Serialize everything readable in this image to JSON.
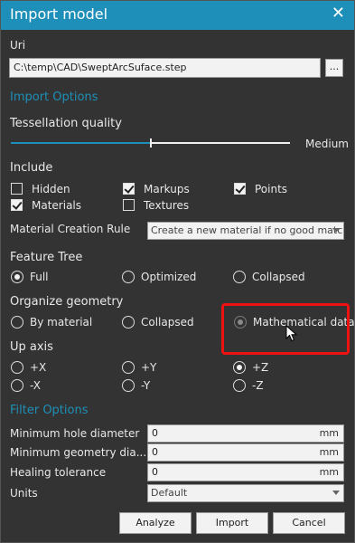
{
  "window": {
    "title": "Import model"
  },
  "uri": {
    "label": "Uri",
    "value": "C:\\temp\\CAD\\SweptArcSuface.step",
    "browse_label": "..."
  },
  "import_options": {
    "heading": "Import Options"
  },
  "tessellation": {
    "label": "Tessellation quality",
    "value_label": "Medium",
    "level": 0.5
  },
  "include": {
    "heading": "Include",
    "items": [
      {
        "label": "Hidden",
        "checked": false
      },
      {
        "label": "Markups",
        "checked": true
      },
      {
        "label": "Points",
        "checked": true
      },
      {
        "label": "Materials",
        "checked": true
      },
      {
        "label": "Textures",
        "checked": false
      }
    ]
  },
  "material_rule": {
    "label": "Material Creation Rule",
    "value": "Create a new material if no good matc..."
  },
  "feature_tree": {
    "heading": "Feature Tree",
    "options": [
      {
        "label": "Full",
        "selected": true
      },
      {
        "label": "Optimized",
        "selected": false
      },
      {
        "label": "Collapsed",
        "selected": false
      }
    ]
  },
  "organize": {
    "heading": "Organize geometry",
    "options": [
      {
        "label": "By material",
        "selected": false
      },
      {
        "label": "Collapsed",
        "selected": false
      },
      {
        "label": "Mathematical data",
        "selected": true
      }
    ]
  },
  "up_axis": {
    "heading": "Up axis",
    "options": [
      {
        "label": "+X",
        "selected": false
      },
      {
        "label": "+Y",
        "selected": false
      },
      {
        "label": "+Z",
        "selected": true
      },
      {
        "label": "-X",
        "selected": false
      },
      {
        "label": "-Y",
        "selected": false
      },
      {
        "label": "-Z",
        "selected": false
      }
    ]
  },
  "filter": {
    "heading": "Filter Options",
    "min_hole": {
      "label": "Minimum hole diameter",
      "value": "0",
      "unit": "mm"
    },
    "min_geom": {
      "label": "Minimum geometry dia...",
      "value": "0",
      "unit": "mm"
    },
    "healing": {
      "label": "Healing tolerance",
      "value": "0",
      "unit": "mm"
    },
    "units": {
      "label": "Units",
      "value": "Default"
    }
  },
  "buttons": {
    "analyze": "Analyze",
    "import": "Import",
    "cancel": "Cancel"
  },
  "colors": {
    "accent": "#1d8fb8",
    "highlight": "#e11111",
    "background": "#333333"
  }
}
